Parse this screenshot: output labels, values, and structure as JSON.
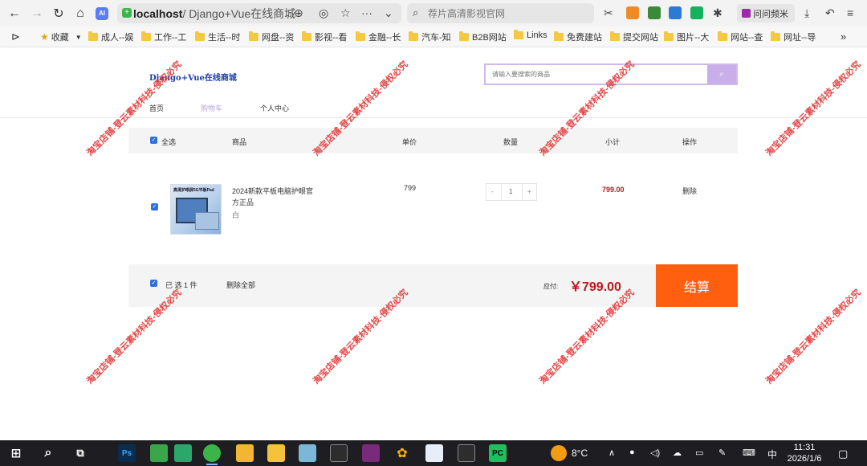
{
  "browser": {
    "address_host": "localhost",
    "address_path": " / Django+Vue在线商城",
    "search_placeholder": "荐片高清影视官网",
    "profile_label": "问问频米",
    "extension_label": "AI",
    "bookmarks": [
      "收藏",
      "成人--娱",
      "工作--工",
      "生活--时",
      "网盘--资",
      "影视--看",
      "金融--长",
      "汽车-知",
      "B2B网站",
      "Links",
      "免费建站",
      "提交网站",
      "图片--大",
      "网站--查",
      "网址--导"
    ]
  },
  "site": {
    "logo": "Django+Vue在线商城",
    "search_placeholder": "请输入要搜索的商品",
    "nav": [
      "首页",
      "购物车",
      "个人中心"
    ]
  },
  "cart": {
    "headers": {
      "select_all": "全选",
      "product": "商品",
      "unit_price": "单价",
      "quantity": "数量",
      "subtotal": "小计",
      "action": "操作"
    },
    "items": [
      {
        "thumb_label": "高清护眼屏5G平板Pad",
        "name": "2024新款平板电脑护眼官方正品",
        "color": "白",
        "price": "799",
        "qty_minus": "-",
        "quantity": "1",
        "qty_plus": "+",
        "subtotal": "799.00",
        "delete": "删除"
      }
    ],
    "footer": {
      "selected": "已 选 1 件",
      "delete_all": "删除全部",
      "due_label": "应付:",
      "due_amount": "￥799.00",
      "checkout": "结算"
    }
  },
  "watermark": "淘宝店铺-登云素材科技-侵权必究",
  "taskbar": {
    "weather": "8°C",
    "ime": "中",
    "time": "11:31",
    "date": "2026/1/6",
    "app_labels": [
      "Ps",
      "PC"
    ]
  },
  "colors": {
    "accent": "#ff5f0e",
    "price_red": "#c0161c",
    "search_purple": "#c9aeea",
    "logo_blue": "#1a3da8"
  }
}
